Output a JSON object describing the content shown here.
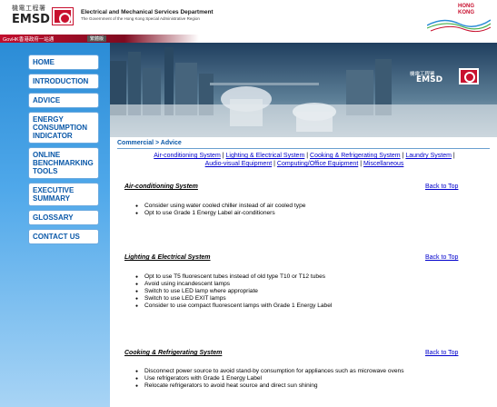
{
  "header": {
    "logo_cn": "機電工程署",
    "logo_abbr": "EMSD",
    "dept_name": "Electrical and Mechanical Services Department",
    "dept_sub": "The Government of the Hong Kong Special Administrative Region",
    "hk_brand_line1": "HONG",
    "hk_brand_line2": "KONG"
  },
  "gov_bar": {
    "link": "GovHK香港政府一站通",
    "button": "繁體版"
  },
  "sidebar": {
    "items": [
      {
        "label": "HOME"
      },
      {
        "label": "INTRODUCTION"
      },
      {
        "label": "ADVICE"
      },
      {
        "label": "ENERGY CONSUMPTION INDICATOR"
      },
      {
        "label": "ONLINE BENCHMARKING TOOLS"
      },
      {
        "label": "EXECUTIVE SUMMARY"
      },
      {
        "label": "GLOSSARY"
      },
      {
        "label": "CONTACT US"
      }
    ]
  },
  "banner": {
    "logo_cn": "機電工程署",
    "logo_abbr": "EMSD"
  },
  "breadcrumb": "Commercial > Advice",
  "topic_links": [
    "Air-conditioning System",
    "Lighting & Electrical System",
    "Cooking & Refrigerating System",
    "Laundry System",
    "Audio-visual Equipment",
    "Computing/Office Equipment",
    "Miscellaneous"
  ],
  "back_to_top": "Back to Top",
  "sections": [
    {
      "title": "Air-conditioning System",
      "bullets": [
        "Consider using water cooled chiller instead of air cooled type",
        "Opt to use Grade 1 Energy Label air-conditioners"
      ]
    },
    {
      "title": "Lighting & Electrical System",
      "bullets": [
        "Opt to use T5 fluorescent tubes instead of old type T10 or T12 tubes",
        "Avoid using incandescent lamps",
        "Switch to use LED lamp where appropriate",
        "Switch to use LED EXIT lamps",
        "Consider to use compact fluorescent lamps with Grade 1 Energy Label"
      ]
    },
    {
      "title": "Cooking & Refrigerating System",
      "bullets": [
        "Disconnect power source to avoid stand-by consumption for appliances such as microwave ovens",
        "Use refrigerators with Grade 1 Energy Label",
        "Relocate refrigerators to avoid heat source and direct sun shining"
      ]
    }
  ],
  "colors": {
    "nav_text": "#0a58a8",
    "link": "#0000cc",
    "brand_red": "#c8102e",
    "sidebar_blue": "#2b8cd6"
  }
}
